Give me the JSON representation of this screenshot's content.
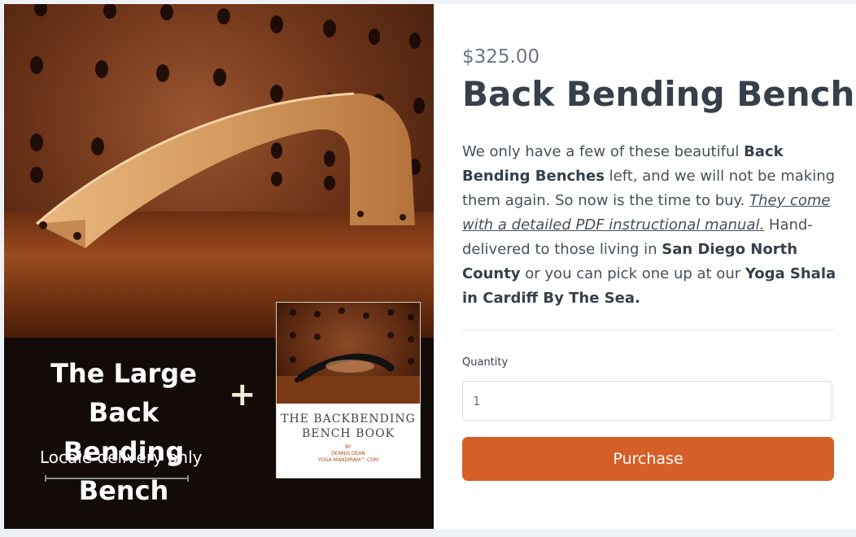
{
  "product": {
    "price": "$325.00",
    "title": "Back Bending Bench",
    "description": [
      {
        "text": "We only have a few of these beautiful ",
        "style": "normal"
      },
      {
        "text": "Back Bending Benches",
        "style": "bold"
      },
      {
        "text": " left, and we will not be making them again. So now is the time to buy. ",
        "style": "normal"
      },
      {
        "text": "They come with a detailed PDF instructional manual.",
        "style": "link"
      },
      {
        "text": " Hand-delivered to those living in ",
        "style": "normal"
      },
      {
        "text": "San Diego North County",
        "style": "bold"
      },
      {
        "text": " or you can pick one up at our ",
        "style": "normal"
      },
      {
        "text": "Yoga Shala in Cardiff By The Sea.",
        "style": "bold"
      }
    ],
    "quantity_label": "Quantity",
    "quantity_value": "1",
    "purchase_label": "Purchase",
    "accent_color": "#d65f27"
  },
  "promo_image": {
    "headline_line1": "The Large Back",
    "headline_line2": "Bending Bench",
    "plus_symbol": "+",
    "delivery_note": "Locale delivery only",
    "book_title_line1": "THE BACKBENDING",
    "book_title_line2": "BENCH BOOK",
    "book_byline1": "BY",
    "book_byline2": "DENNIS DEAN",
    "book_byline3": "YOGA MANDIRAM™.COM"
  }
}
